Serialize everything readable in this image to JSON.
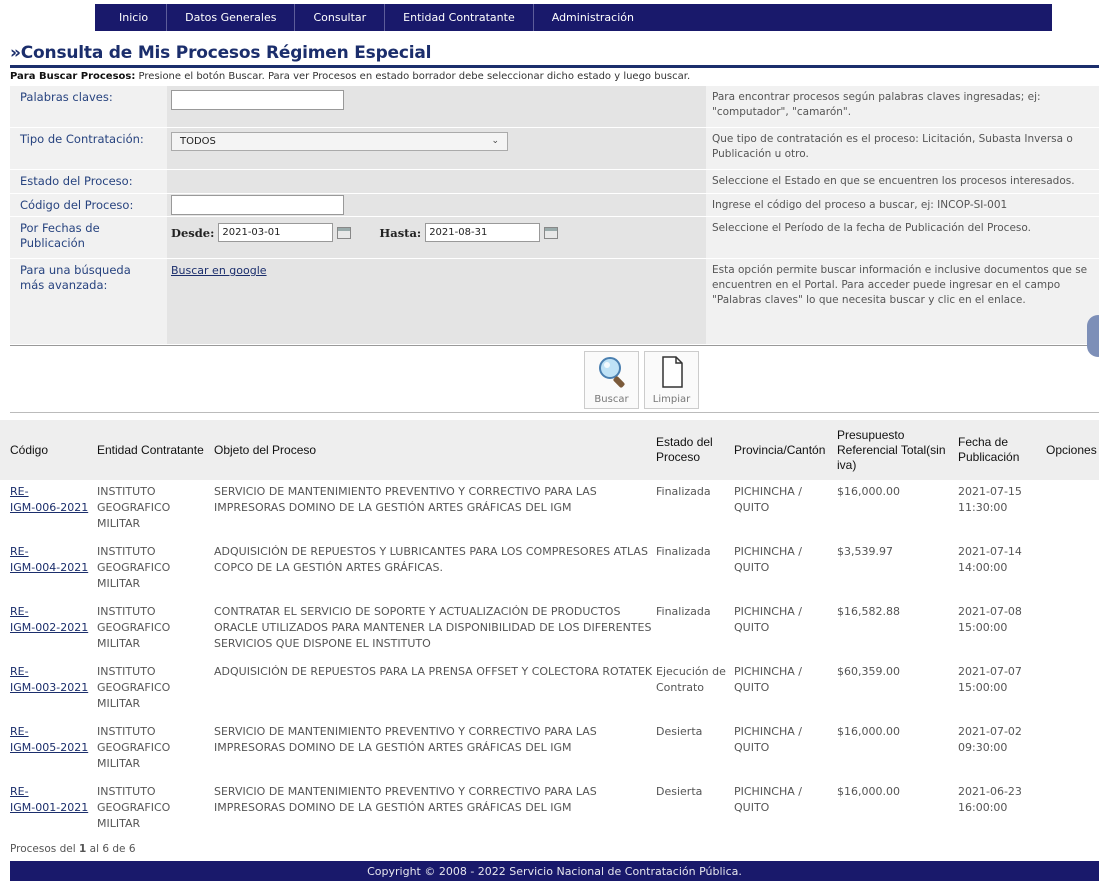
{
  "nav": [
    "Inicio",
    "Datos Generales",
    "Consultar",
    "Entidad Contratante",
    "Administración"
  ],
  "title": "»Consulta de Mis Procesos Régimen Especial",
  "instructions": {
    "bold": "Para Buscar Procesos:",
    "text": " Presione el botón Buscar. Para ver Procesos en estado borrador debe seleccionar dicho estado y luego buscar."
  },
  "form": {
    "keywords_label": "Palabras claves:",
    "keywords_value": "",
    "keywords_help": "Para encontrar procesos según palabras claves ingresadas; ej: \"computador\", \"camarón\".",
    "tipo_label": "Tipo de Contratación:",
    "tipo_value": "TODOS",
    "tipo_help": "Que tipo de contratación es el proceso: Licitación, Subasta Inversa o Publicación u otro.",
    "estado_label": "Estado del Proceso:",
    "estado_help": "Seleccione el Estado en que se encuentren los procesos interesados.",
    "codigo_label": "Código del Proceso:",
    "codigo_value": "",
    "codigo_help": "Ingrese el código del proceso a buscar, ej: INCOP-SI-001",
    "fechas_label": "Por Fechas de Publicación",
    "desde_label": "Desde:",
    "desde_value": "2021-03-01",
    "hasta_label": "Hasta:",
    "hasta_value": "2021-08-31",
    "fechas_help": "Seleccione el Período de la fecha de Publicación del Proceso.",
    "avanzada_label": "Para una búsqueda más avanzada:",
    "google_link": "Buscar en google",
    "avanzada_help": "Esta opción permite buscar información e inclusive documentos que se encuentren en el Portal. Para acceder puede ingresar en el campo \"Palabras claves\" lo que necesita buscar y clic en el enlace."
  },
  "buttons": {
    "buscar": "Buscar",
    "limpiar": "Limpiar"
  },
  "table": {
    "headers": [
      "Código",
      "Entidad Contratante",
      "Objeto del Proceso",
      "Estado del Proceso",
      "Provincia/Cantón",
      "Presupuesto Referencial Total(sin iva)",
      "Fecha de Publicación",
      "Opciones"
    ],
    "rows": [
      {
        "code1": "RE-",
        "code2": "IGM-006-2021",
        "entidad": "INSTITUTO GEOGRAFICO MILITAR",
        "objeto": "SERVICIO DE MANTENIMIENTO PREVENTIVO Y CORRECTIVO PARA LAS IMPRESORAS DOMINO DE LA GESTIÓN ARTES GRÁFICAS DEL IGM",
        "estado": "Finalizada",
        "prov": "PICHINCHA / QUITO",
        "pres": "$16,000.00",
        "fecha": "2021-07-15 11:30:00"
      },
      {
        "code1": "RE-",
        "code2": "IGM-004-2021",
        "entidad": "INSTITUTO GEOGRAFICO MILITAR",
        "objeto": "ADQUISICIÓN DE REPUESTOS Y LUBRICANTES PARA LOS COMPRESORES ATLAS COPCO DE LA GESTIÓN ARTES GRÁFICAS.",
        "estado": "Finalizada",
        "prov": "PICHINCHA / QUITO",
        "pres": "$3,539.97",
        "fecha": "2021-07-14 14:00:00"
      },
      {
        "code1": "RE-",
        "code2": "IGM-002-2021",
        "entidad": "INSTITUTO GEOGRAFICO MILITAR",
        "objeto": "CONTRATAR EL SERVICIO DE SOPORTE Y ACTUALIZACIÓN DE PRODUCTOS ORACLE UTILIZADOS PARA MANTENER LA DISPONIBILIDAD DE LOS DIFERENTES SERVICIOS QUE DISPONE EL INSTITUTO",
        "estado": "Finalizada",
        "prov": "PICHINCHA / QUITO",
        "pres": "$16,582.88",
        "fecha": "2021-07-08 15:00:00"
      },
      {
        "code1": "RE-",
        "code2": "IGM-003-2021",
        "entidad": "INSTITUTO GEOGRAFICO MILITAR",
        "objeto": "ADQUISICIÓN DE REPUESTOS PARA LA PRENSA OFFSET Y COLECTORA ROTATEK",
        "estado": "Ejecución de Contrato",
        "prov": "PICHINCHA / QUITO",
        "pres": "$60,359.00",
        "fecha": "2021-07-07 15:00:00"
      },
      {
        "code1": "RE-",
        "code2": "IGM-005-2021",
        "entidad": "INSTITUTO GEOGRAFICO MILITAR",
        "objeto": "SERVICIO DE MANTENIMIENTO PREVENTIVO Y CORRECTIVO PARA LAS IMPRESORAS DOMINO DE LA GESTIÓN ARTES GRÁFICAS DEL IGM",
        "estado": "Desierta",
        "prov": "PICHINCHA / QUITO",
        "pres": "$16,000.00",
        "fecha": "2021-07-02 09:30:00"
      },
      {
        "code1": "RE-",
        "code2": "IGM-001-2021",
        "entidad": "INSTITUTO GEOGRAFICO MILITAR",
        "objeto": "SERVICIO DE MANTENIMIENTO PREVENTIVO Y CORRECTIVO PARA LAS IMPRESORAS DOMINO DE LA GESTIÓN ARTES GRÁFICAS DEL IGM",
        "estado": "Desierta",
        "prov": "PICHINCHA / QUITO",
        "pres": "$16,000.00",
        "fecha": "2021-06-23 16:00:00"
      }
    ]
  },
  "pagination": {
    "prefix": "Procesos del ",
    "from": "1",
    "mid1": " al ",
    "to": "6",
    "mid2": " de ",
    "total": "6"
  },
  "footer": "Copyright © 2008 - 2022 Servicio Nacional de Contratación Pública."
}
